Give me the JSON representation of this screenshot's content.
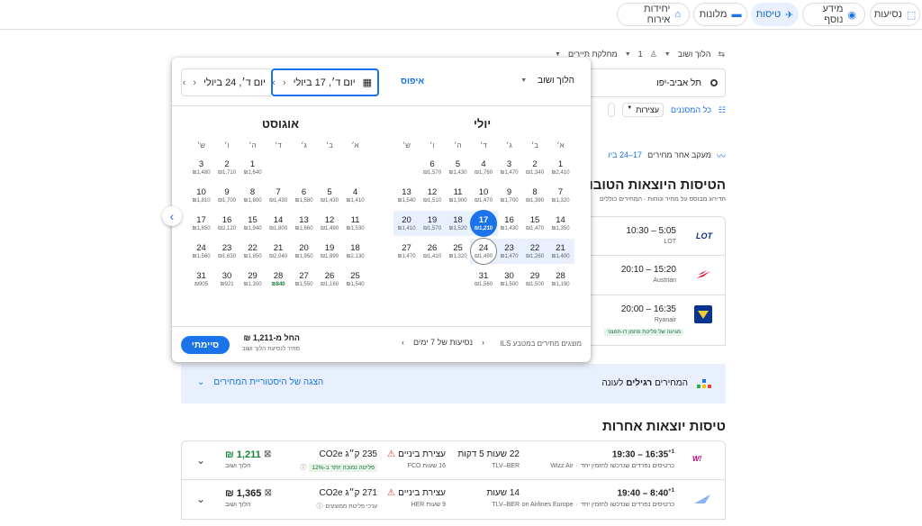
{
  "nav": {
    "chips": [
      {
        "label": "נסיעות",
        "icon": "trips-icon",
        "active": false
      },
      {
        "label": "מידע נוסף",
        "icon": "explore-icon",
        "active": false
      },
      {
        "label": "טיסות",
        "icon": "flight-icon",
        "active": true
      },
      {
        "label": "מלונות",
        "icon": "hotel-icon",
        "active": false
      },
      {
        "label": "יחידות אירוח",
        "icon": "home-icon",
        "active": false
      }
    ]
  },
  "search": {
    "trip_type": "הלוך ושוב",
    "passengers": "1",
    "cabin": "מחלקת תיירים",
    "origin": "תל אביב-יפו",
    "trip_type_popup": "הלוך ושוב",
    "reset": "איפוס",
    "depart_date": "יום ד׳, 17 ביולי",
    "return_date": "יום ד׳, 24 ביולי",
    "filters_all": "כל המסננים",
    "filter_stops": "עצירות"
  },
  "calendar": {
    "weekdays": [
      "א׳",
      "ב׳",
      "ג׳",
      "ד׳",
      "ה׳",
      "ו׳",
      "ש׳"
    ],
    "months": [
      {
        "name": "יולי",
        "weeks": [
          [
            [
              "1",
              "₪2,410"
            ],
            [
              "2",
              "₪1,340"
            ],
            [
              "3",
              "₪1,470"
            ],
            [
              "4",
              "₪1,760"
            ],
            [
              "5",
              "₪1,430"
            ],
            [
              "6",
              "₪1,570"
            ],
            null
          ],
          [
            [
              "7",
              "₪1,320"
            ],
            [
              "8",
              "₪1,390"
            ],
            [
              "9",
              "₪1,700"
            ],
            [
              "10",
              "₪1,470"
            ],
            [
              "11",
              "₪1,900"
            ],
            [
              "12",
              "₪1,510"
            ],
            [
              "13",
              "₪1,540"
            ]
          ],
          [
            [
              "14",
              "₪1,350"
            ],
            [
              "15",
              "₪1,470"
            ],
            [
              "16",
              "₪1,430"
            ],
            [
              "17",
              "₪1,210"
            ],
            [
              "18",
              "₪1,520"
            ],
            [
              "19",
              "₪1,570"
            ],
            [
              "20",
              "₪1,410"
            ]
          ],
          [
            [
              "21",
              "₪1,400"
            ],
            [
              "22",
              "₪1,260"
            ],
            [
              "23",
              "₪1,470"
            ],
            [
              "24",
              "₪1,490"
            ],
            [
              "25",
              "₪1,320"
            ],
            [
              "26",
              "₪1,410"
            ],
            [
              "27",
              "₪1,470"
            ]
          ],
          [
            [
              "28",
              "₪1,190"
            ],
            [
              "29",
              "₪1,500"
            ],
            [
              "30",
              "₪1,500"
            ],
            [
              "31",
              "₪1,560"
            ],
            null,
            null,
            null
          ]
        ]
      },
      {
        "name": "אוגוסט",
        "weeks": [
          [
            null,
            null,
            null,
            null,
            [
              "1",
              "₪1,640"
            ],
            [
              "2",
              "₪1,710"
            ],
            [
              "3",
              "₪1,480"
            ]
          ],
          [
            [
              "4",
              "₪1,410"
            ],
            [
              "5",
              "₪1,430"
            ],
            [
              "6",
              "₪1,580"
            ],
            [
              "7",
              "₪1,430"
            ],
            [
              "8",
              "₪1,800"
            ],
            [
              "9",
              "₪1,700"
            ],
            [
              "10",
              "₪1,810"
            ]
          ],
          [
            [
              "11",
              "₪1,530"
            ],
            [
              "12",
              "₪1,490"
            ],
            [
              "13",
              "₪1,660"
            ],
            [
              "14",
              "₪1,800"
            ],
            [
              "15",
              "₪1,940"
            ],
            [
              "16",
              "₪2,120"
            ],
            [
              "17",
              "₪1,850"
            ]
          ],
          [
            [
              "18",
              "₪2,130"
            ],
            [
              "19",
              "₪1,890"
            ],
            [
              "20",
              "₪1,950"
            ],
            [
              "21",
              "₪2,040"
            ],
            [
              "22",
              "₪1,850"
            ],
            [
              "23",
              "₪1,630"
            ],
            [
              "24",
              "₪1,560"
            ]
          ],
          [
            [
              "25",
              "₪1,540"
            ],
            [
              "26",
              "₪1,160"
            ],
            [
              "27",
              "₪1,550"
            ],
            [
              "28",
              "₪840"
            ],
            [
              "29",
              "₪1,300"
            ],
            [
              "30",
              "₪921"
            ],
            [
              "31",
              "₪905"
            ]
          ]
        ]
      }
    ],
    "footer_currency": "מוצגים מחירים במטבע ILS",
    "footer_trip_len": "נסיעות של 7 ימים",
    "footer_from_price": "החל מ-‎1,211 ₪",
    "footer_from_sub": "מחיר לנסיעת הלוך ושוב",
    "done": "סיימתי"
  },
  "background": {
    "price_track": "מעקב אחר מחירים",
    "price_track_dates": "17–24 ביו",
    "best_title": "הטיסות היוצאות הטובות ביור",
    "best_sub": "הדירוג מבוסס על מחיר ונוחות  ·  המחירים כוללים",
    "best_flights": [
      {
        "time": "10:30 – 5:05",
        "airline": "LOT",
        "logo": "LOT"
      },
      {
        "time": "20:10 – 15:20",
        "airline": "Austrian",
        "logo": ""
      },
      {
        "time": "20:00 – 16:35",
        "airline": "Ryanair",
        "logo": "",
        "badge": "מגיעה של פליטת פחמן דו-חמצני"
      }
    ],
    "history_status_a": "המחירים",
    "history_status_b": "רגילים",
    "history_status_c": "לעונה",
    "history_link": "הצגה של היסטוריית המחירים",
    "other_title": "טיסות יוצאות אחרות",
    "other_flights": [
      {
        "time": "19:30 – 16:35",
        "plus": "+1",
        "airline": "Wizz Air",
        "sub": "כרטיסים נפרדים שנרכשו להזמין יחד",
        "duration": "22 שעות 5 דקות",
        "route": "TLV–BER",
        "stops": "עצירת ביניים",
        "stops_sub": "16 שעות FCO",
        "co2": "235 ק״ג CO2e",
        "co2_badge": "פליטה נמוכה יותר ב-‎12%",
        "price": "1,211 ₪",
        "price_sub": "הלוך ושוב"
      },
      {
        "time": "19:40 – 8:40",
        "plus": "+1",
        "airline": "on Airlines Europe",
        "sub": "כרטיסים נפרדים שנרכשו להזמין יחד",
        "duration": "14 שעות",
        "route": "TLV–BER",
        "stops": "עצירת ביניים",
        "stops_sub": "9 שעות HER",
        "co2": "271 ק״ג CO2e",
        "co2_badge": "ערכי פליטת ממוצעים",
        "price": "1,365 ₪",
        "price_sub": "הלוך ושוב"
      }
    ]
  },
  "colors": {
    "accent": "#1a73e8",
    "range": "#e8f0fe",
    "price_green": "#188038"
  }
}
